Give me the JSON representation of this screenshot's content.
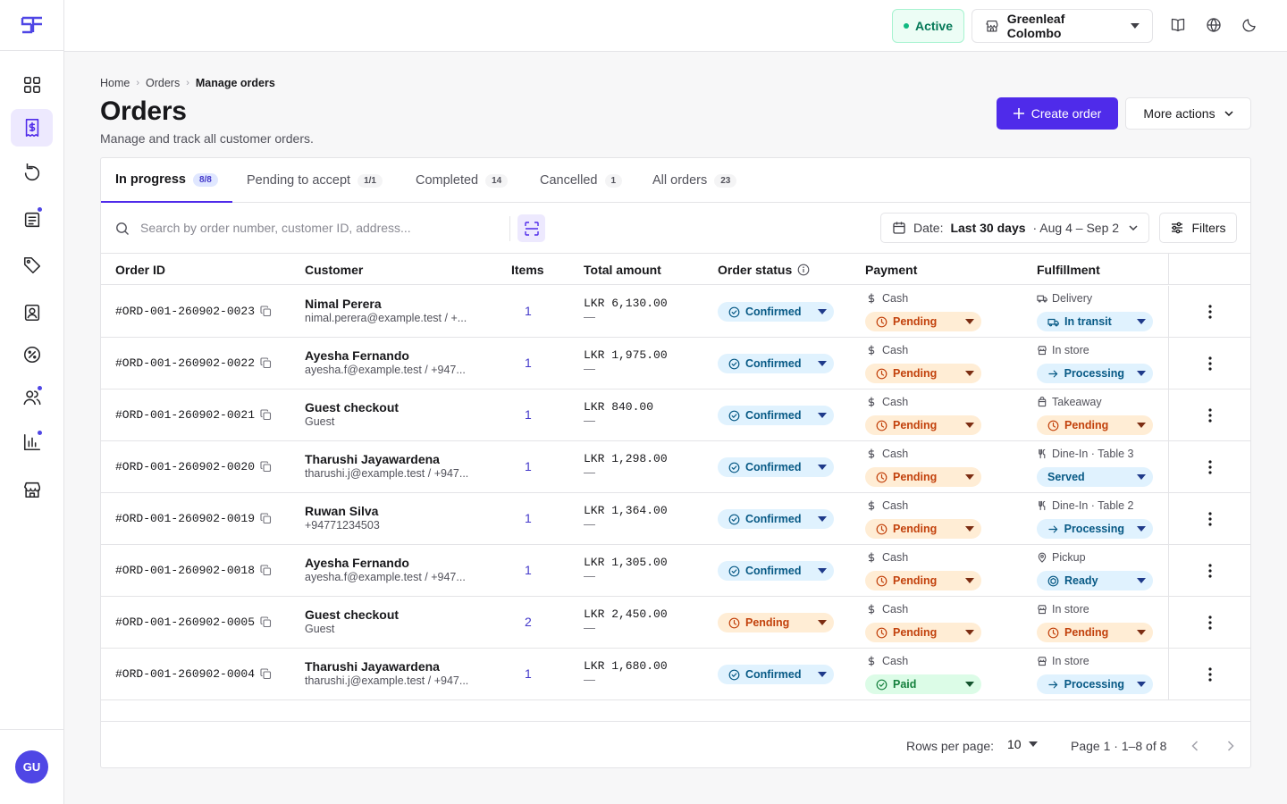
{
  "app": {
    "logo_text": "SF"
  },
  "sidebar": {
    "items": [
      {
        "icon": "dashboard-grid-icon",
        "active": false
      },
      {
        "icon": "orders-invoice-icon",
        "active": true
      },
      {
        "icon": "refresh-history-icon",
        "active": false
      },
      {
        "icon": "menu-book-icon",
        "active": false
      },
      {
        "icon": "tag-icon",
        "active": false
      },
      {
        "icon": "contacts-icon",
        "active": false
      },
      {
        "icon": "discount-icon",
        "active": false
      },
      {
        "icon": "users-icon",
        "active": false
      },
      {
        "icon": "analytics-chart-icon",
        "active": false
      },
      {
        "icon": "store-icon",
        "active": false
      }
    ],
    "user_initials": "GU"
  },
  "topbar": {
    "status": "Active",
    "store_name": "Greenleaf Colombo"
  },
  "breadcrumb": [
    "Home",
    "Orders",
    "Manage orders"
  ],
  "page": {
    "title": "Orders",
    "subtitle": "Manage and track all customer orders.",
    "create_label": "Create order",
    "more_label": "More actions"
  },
  "tabs": [
    {
      "label": "In progress",
      "count": "8/8"
    },
    {
      "label": "Pending to accept",
      "count": "1/1"
    },
    {
      "label": "Completed",
      "count": "14"
    },
    {
      "label": "Cancelled",
      "count": "1"
    },
    {
      "label": "All orders",
      "count": "23"
    }
  ],
  "toolbar": {
    "search_placeholder": "Search by order number, customer ID, address...",
    "date_prefix": "Date:",
    "date_range_name": "Last 30 days",
    "date_range": "· Aug 4 – Sep 2",
    "filters_label": "Filters"
  },
  "table": {
    "headers": {
      "order_id": "Order ID",
      "customer": "Customer",
      "items": "Items",
      "total": "Total amount",
      "status": "Order status",
      "payment": "Payment",
      "fulfillment": "Fulfillment"
    },
    "rows": [
      {
        "id": "#ORD-001-260902-0023",
        "name": "Nimal Perera",
        "sub": "nimal.perera@example.test / +...",
        "items": "1",
        "amount": "LKR 6,130.00",
        "amount_sub": "—",
        "status": "Confirmed",
        "status_color": "blue",
        "pay_method": "Cash",
        "pay_status": "Pending",
        "pay_color": "amber",
        "ful_method": "Delivery",
        "ful_icon": "truck-icon",
        "ful_status": "In transit",
        "ful_color": "blue",
        "ful_status_icon": "truck-icon"
      },
      {
        "id": "#ORD-001-260902-0022",
        "name": "Ayesha Fernando",
        "sub": "ayesha.f@example.test / +947...",
        "items": "1",
        "amount": "LKR 1,975.00",
        "amount_sub": "—",
        "status": "Confirmed",
        "status_color": "blue",
        "pay_method": "Cash",
        "pay_status": "Pending",
        "pay_color": "amber",
        "ful_method": "In store",
        "ful_icon": "store-icon",
        "ful_status": "Processing",
        "ful_color": "blue",
        "ful_status_icon": "arrow-right-icon"
      },
      {
        "id": "#ORD-001-260902-0021",
        "name": "Guest checkout",
        "sub": "Guest",
        "items": "1",
        "amount": "LKR 840.00",
        "amount_sub": "—",
        "status": "Confirmed",
        "status_color": "blue",
        "pay_method": "Cash",
        "pay_status": "Pending",
        "pay_color": "amber",
        "ful_method": "Takeaway",
        "ful_icon": "bag-icon",
        "ful_status": "Pending",
        "ful_color": "amber",
        "ful_status_icon": "clock-icon"
      },
      {
        "id": "#ORD-001-260902-0020",
        "name": "Tharushi Jayawardena",
        "sub": "tharushi.j@example.test / +947...",
        "items": "1",
        "amount": "LKR 1,298.00",
        "amount_sub": "—",
        "status": "Confirmed",
        "status_color": "blue",
        "pay_method": "Cash",
        "pay_status": "Pending",
        "pay_color": "amber",
        "ful_method": "Dine-In · Table 3",
        "ful_icon": "utensils-icon",
        "ful_status": "Served",
        "ful_color": "blue",
        "ful_status_icon": ""
      },
      {
        "id": "#ORD-001-260902-0019",
        "name": "Ruwan Silva",
        "sub": "+94771234503",
        "items": "1",
        "amount": "LKR 1,364.00",
        "amount_sub": "—",
        "status": "Confirmed",
        "status_color": "blue",
        "pay_method": "Cash",
        "pay_status": "Pending",
        "pay_color": "amber",
        "ful_method": "Dine-In · Table 2",
        "ful_icon": "utensils-icon",
        "ful_status": "Processing",
        "ful_color": "blue",
        "ful_status_icon": "arrow-right-icon"
      },
      {
        "id": "#ORD-001-260902-0018",
        "name": "Ayesha Fernando",
        "sub": "ayesha.f@example.test / +947...",
        "items": "1",
        "amount": "LKR 1,305.00",
        "amount_sub": "—",
        "status": "Confirmed",
        "status_color": "blue",
        "pay_method": "Cash",
        "pay_status": "Pending",
        "pay_color": "amber",
        "ful_method": "Pickup",
        "ful_icon": "map-pin-icon",
        "ful_status": "Ready",
        "ful_color": "blue",
        "ful_status_icon": "package-icon"
      },
      {
        "id": "#ORD-001-260902-0005",
        "name": "Guest checkout",
        "sub": "Guest",
        "items": "2",
        "amount": "LKR 2,450.00",
        "amount_sub": "—",
        "status": "Pending",
        "status_color": "amber",
        "pay_method": "Cash",
        "pay_status": "Pending",
        "pay_color": "amber",
        "ful_method": "In store",
        "ful_icon": "store-icon",
        "ful_status": "Pending",
        "ful_color": "amber",
        "ful_status_icon": "clock-icon"
      },
      {
        "id": "#ORD-001-260902-0004",
        "name": "Tharushi Jayawardena",
        "sub": "tharushi.j@example.test / +947...",
        "items": "1",
        "amount": "LKR 1,680.00",
        "amount_sub": "—",
        "status": "Confirmed",
        "status_color": "blue",
        "pay_method": "Cash",
        "pay_status": "Paid",
        "pay_color": "green",
        "ful_method": "In store",
        "ful_icon": "store-icon",
        "ful_status": "Processing",
        "ful_color": "blue",
        "ful_status_icon": "arrow-right-icon"
      }
    ]
  },
  "pagination": {
    "rows_label": "Rows per page:",
    "rows_value": "10",
    "page_info": "Page 1 · 1–8 of 8"
  },
  "colors": {
    "accent": "#4f2bea",
    "confirmed_bg": "#e0f2fe",
    "pending_bg": "#ffedd5",
    "paid_bg": "#dcfce7"
  }
}
